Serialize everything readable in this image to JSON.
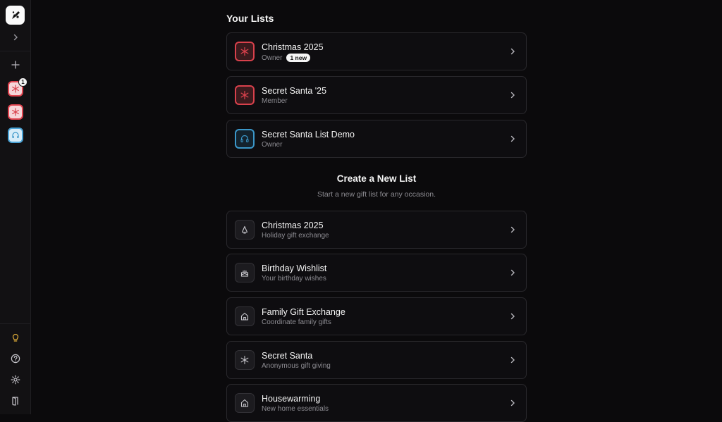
{
  "your_lists": {
    "title": "Your Lists",
    "items": [
      {
        "title": "Christmas 2025",
        "role": "Owner",
        "badge": "1 new",
        "icon": "snowflake-icon",
        "color": "#d9414c"
      },
      {
        "title": "Secret Santa '25",
        "role": "Member",
        "icon": "snowflake-icon",
        "color": "#d9414c"
      },
      {
        "title": "Secret Santa List Demo",
        "role": "Owner",
        "icon": "headphones-icon",
        "color": "#3b97c9"
      }
    ]
  },
  "create": {
    "title": "Create a New List",
    "subtitle": "Start a new gift list for any occasion.",
    "templates": [
      {
        "title": "Christmas 2025",
        "subtitle": "Holiday gift exchange",
        "icon": "bell-icon"
      },
      {
        "title": "Birthday Wishlist",
        "subtitle": "Your birthday wishes",
        "icon": "cake-icon"
      },
      {
        "title": "Family Gift Exchange",
        "subtitle": "Coordinate family gifts",
        "icon": "home-icon"
      },
      {
        "title": "Secret Santa",
        "subtitle": "Anonymous gift giving",
        "icon": "snowflake-icon"
      },
      {
        "title": "Housewarming",
        "subtitle": "New home essentials",
        "icon": "home-icon"
      }
    ]
  },
  "sidebar": {
    "notification_count": "1",
    "icons": [
      "logo-icon",
      "chevron-right-icon",
      "plus-icon",
      "lightbulb-icon",
      "help-icon",
      "gear-icon",
      "door-icon"
    ]
  }
}
